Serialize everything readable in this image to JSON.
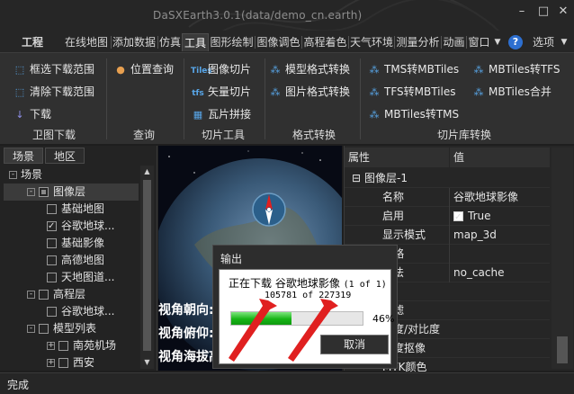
{
  "window": {
    "title": "DaSXEarth3.0.1(data/demo_cn.earth)",
    "controls": [
      "–",
      "□",
      "✕"
    ]
  },
  "menu": {
    "items": [
      "工程",
      "在线地图",
      "添加数据",
      "仿真",
      "工具",
      "图形绘制",
      "图像调色",
      "高程着色",
      "天气环境",
      "测量分析",
      "动画",
      "窗口"
    ],
    "active": "工具",
    "help_icon": "?",
    "options_label": "选项"
  },
  "ribbon": {
    "groups": [
      {
        "label": "卫图下载",
        "buttons": [
          {
            "label": "框选下载范围",
            "icon": "select-area-icon"
          },
          {
            "label": "清除下载范围",
            "icon": "clear-area-icon"
          },
          {
            "label": "下载",
            "icon": "download-icon"
          }
        ]
      },
      {
        "label": "查询",
        "buttons": [
          {
            "label": "位置查询",
            "icon": "location-pin-icon"
          }
        ]
      },
      {
        "label": "切片工具",
        "buttons": [
          {
            "label": "图像切片",
            "icon": "tiles-icon"
          },
          {
            "label": "矢量切片",
            "icon": "tfs-icon"
          },
          {
            "label": "瓦片拼接",
            "icon": "tile-merge-icon"
          }
        ]
      },
      {
        "label": "格式转换",
        "buttons": [
          {
            "label": "模型格式转换",
            "icon": "model-convert-icon"
          },
          {
            "label": "图片格式转换",
            "icon": "image-convert-icon"
          }
        ]
      },
      {
        "label": "切片库转换",
        "buttons": [
          {
            "label": "TMS转MBTiles",
            "icon": "convert-icon"
          },
          {
            "label": "MBTiles转TFS",
            "icon": "convert-icon"
          },
          {
            "label": "TFS转MBTiles",
            "icon": "convert-icon"
          },
          {
            "label": "MBTiles合并",
            "icon": "merge-icon"
          },
          {
            "label": "MBTiles转TMS",
            "icon": "convert-icon"
          }
        ]
      }
    ]
  },
  "left_panel": {
    "tabs": [
      "场景",
      "地区"
    ],
    "active_tab": "场景",
    "tree": [
      {
        "label": "场景",
        "expander": "-",
        "check": null
      },
      {
        "label": "图像层",
        "expander": "-",
        "check": "partial"
      },
      {
        "label": "基础地图",
        "expander": null,
        "check": "off"
      },
      {
        "label": "谷歌地球...",
        "expander": null,
        "check": "on"
      },
      {
        "label": "基础影像",
        "expander": null,
        "check": "off"
      },
      {
        "label": "高德地图",
        "expander": null,
        "check": "off"
      },
      {
        "label": "天地图道...",
        "expander": null,
        "check": "off"
      },
      {
        "label": "高程层",
        "expander": "-",
        "check": "off"
      },
      {
        "label": "谷歌地球...",
        "expander": null,
        "check": "off"
      },
      {
        "label": "模型列表",
        "expander": "-",
        "check": "off"
      },
      {
        "label": "南苑机场",
        "expander": "+",
        "check": "off"
      },
      {
        "label": "西安",
        "expander": "+",
        "check": "off"
      }
    ]
  },
  "view3d": {
    "overlays": [
      "视角朝向:",
      "视角俯仰:",
      "视角海拔高"
    ]
  },
  "properties": {
    "header_name": "属性",
    "header_value": "值",
    "group_label": "图像层-1",
    "rows": [
      {
        "name": "名称",
        "value": "谷歌地球影像",
        "checkbox": false
      },
      {
        "name": "启用",
        "value": "True",
        "checkbox": true
      },
      {
        "name": "显示模式",
        "value": "map_3d",
        "checkbox": false
      },
      {
        "name": "策略",
        "value": "",
        "checkbox": false
      },
      {
        "name": "方法",
        "value": "no_cache",
        "checkbox": false
      },
      {
        "name": "组",
        "value": "",
        "checkbox": false
      },
      {
        "name": "过滤",
        "value": "",
        "checkbox": false
      },
      {
        "name": "亮度/对比度",
        "value": "",
        "checkbox": false
      },
      {
        "name": "色度抠像",
        "value": "",
        "checkbox": false
      },
      {
        "name": "MYK颜色",
        "value": "",
        "checkbox": false
      }
    ]
  },
  "dialog": {
    "title": "输出",
    "status_prefix": "正在下载 谷歌地球影像",
    "status_count": "(1 of 1)",
    "progress_text": "105781 of 227319",
    "progress_fraction": 0.46,
    "percent_label": "46%",
    "cancel_label": "取消"
  },
  "status_bar": {
    "text": "完成"
  },
  "colors": {
    "accent_blue": "#58a6e8",
    "progress_green": "#16b416",
    "annotation_red": "#e02020"
  }
}
